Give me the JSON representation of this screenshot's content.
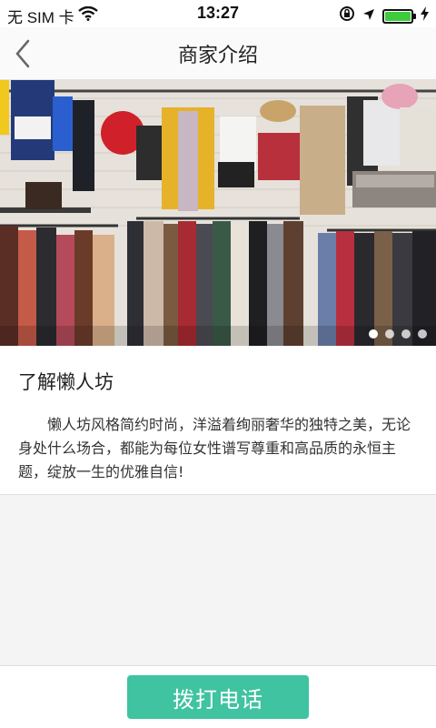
{
  "status_bar": {
    "carrier": "无 SIM 卡",
    "time": "13:27",
    "icons": [
      "wifi-icon",
      "rotation-lock-icon",
      "location-arrow-icon",
      "battery-icon",
      "charging-icon"
    ]
  },
  "nav": {
    "title": "商家介绍",
    "back_icon": "chevron-left-icon"
  },
  "banner": {
    "description_icon": "store-photo",
    "page_count": 4,
    "active_index": 0
  },
  "intro": {
    "title": "了解懒人坊",
    "body": "懒人坊风格简约时尚，洋溢着绚丽奢华的独特之美，无论身处什么场合，都能为每位女性谱写尊重和高品质的永恒主题，绽放一生的优雅自信!"
  },
  "footer": {
    "call_label": "拨打电话"
  },
  "colors": {
    "accent": "#3fc3a0",
    "battery": "#3ecb3c"
  }
}
